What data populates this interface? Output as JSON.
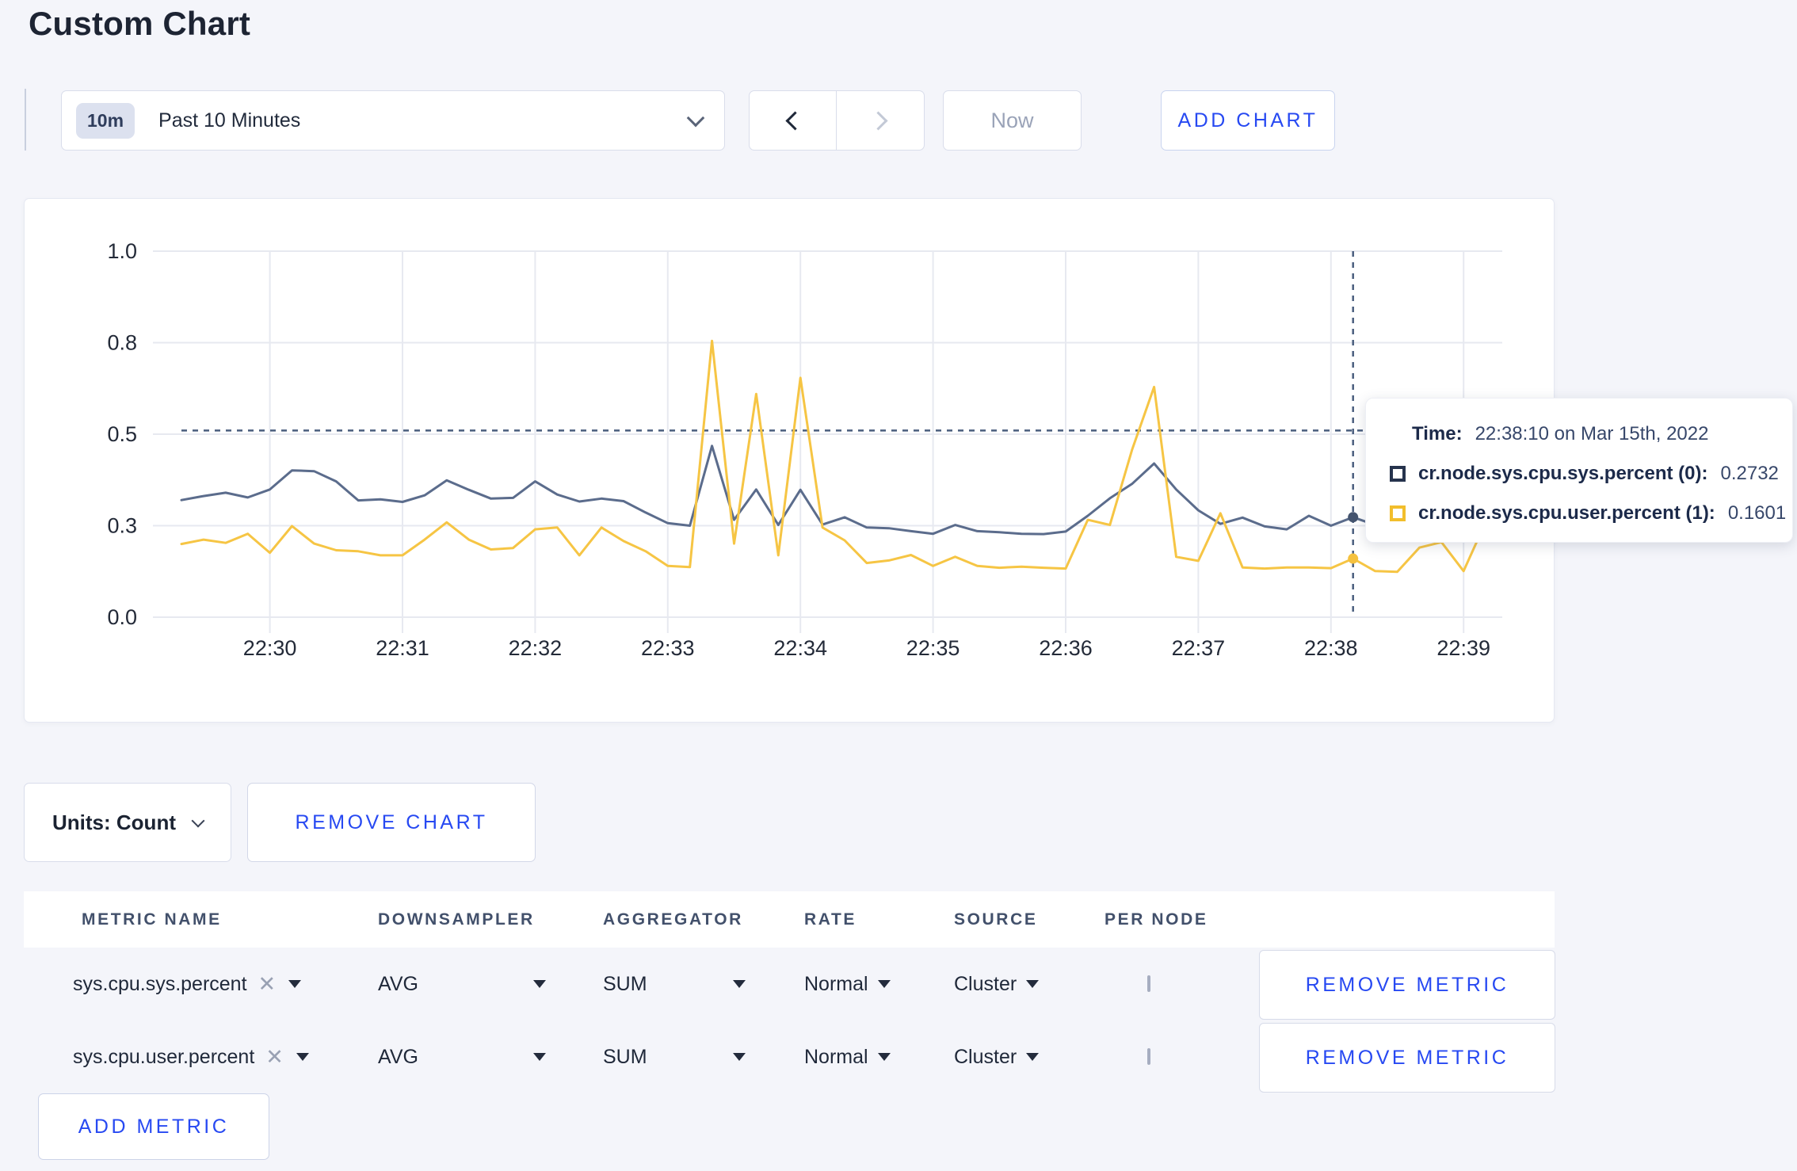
{
  "page": {
    "title": "Custom Chart"
  },
  "toolbar": {
    "time_window": {
      "badge": "10m",
      "label": "Past 10 Minutes"
    },
    "now_button": "Now",
    "add_chart_button": "ADD CHART"
  },
  "tooltip": {
    "time_label": "Time:",
    "time_value": "22:38:10 on Mar 15th, 2022",
    "series": [
      {
        "name": "cr.node.sys.cpu.sys.percent (0):",
        "value": "0.2732",
        "swatch_color": "#26334d"
      },
      {
        "name": "cr.node.sys.cpu.user.percent (1):",
        "value": "0.1601",
        "swatch_color": "#f2be2c"
      }
    ]
  },
  "units_bar": {
    "units_label": "Units: Count",
    "remove_chart_button": "REMOVE CHART"
  },
  "metrics_table": {
    "columns": [
      "METRIC NAME",
      "DOWNSAMPLER",
      "AGGREGATOR",
      "RATE",
      "SOURCE",
      "PER NODE"
    ],
    "rows": [
      {
        "metric": "sys.cpu.sys.percent",
        "downsampler": "AVG",
        "aggregator": "SUM",
        "rate": "Normal",
        "source": "Cluster",
        "per_node_checked": false,
        "remove_label": "REMOVE METRIC"
      },
      {
        "metric": "sys.cpu.user.percent",
        "downsampler": "AVG",
        "aggregator": "SUM",
        "rate": "Normal",
        "source": "Cluster",
        "per_node_checked": false,
        "remove_label": "REMOVE METRIC"
      }
    ],
    "add_metric_button": "ADD METRIC"
  },
  "chart_data": {
    "type": "line",
    "title": "",
    "xlabel": "",
    "ylabel": "",
    "ylim": [
      0,
      1
    ],
    "grid": true,
    "x_start_label": "22:29:20",
    "x_interval_sec": 10,
    "x_ticks": [
      {
        "offset_sec": 40,
        "label": "22:30"
      },
      {
        "offset_sec": 100,
        "label": "22:31"
      },
      {
        "offset_sec": 160,
        "label": "22:32"
      },
      {
        "offset_sec": 220,
        "label": "22:33"
      },
      {
        "offset_sec": 280,
        "label": "22:34"
      },
      {
        "offset_sec": 340,
        "label": "22:35"
      },
      {
        "offset_sec": 400,
        "label": "22:36"
      },
      {
        "offset_sec": 460,
        "label": "22:37"
      },
      {
        "offset_sec": 520,
        "label": "22:38"
      },
      {
        "offset_sec": 580,
        "label": "22:39"
      }
    ],
    "y_ticks": [
      {
        "value": 0,
        "label": "0.0"
      },
      {
        "value": 0.25,
        "label": "0.3"
      },
      {
        "value": 0.5,
        "label": "0.5"
      },
      {
        "value": 0.75,
        "label": "0.8"
      },
      {
        "value": 1,
        "label": "1.0"
      }
    ],
    "series": [
      {
        "name": "cr.node.sys.cpu.sys.percent (0)",
        "color": "#5b6c8c",
        "values": [
          0.32,
          0.331,
          0.34,
          0.327,
          0.349,
          0.401,
          0.399,
          0.371,
          0.319,
          0.322,
          0.315,
          0.333,
          0.374,
          0.348,
          0.324,
          0.326,
          0.371,
          0.335,
          0.316,
          0.324,
          0.317,
          0.286,
          0.257,
          0.25,
          0.468,
          0.266,
          0.349,
          0.252,
          0.348,
          0.253,
          0.273,
          0.245,
          0.243,
          0.235,
          0.228,
          0.252,
          0.235,
          0.232,
          0.228,
          0.227,
          0.234,
          0.277,
          0.325,
          0.364,
          0.42,
          0.349,
          0.292,
          0.255,
          0.272,
          0.248,
          0.24,
          0.277,
          0.25,
          0.2732,
          0.252,
          0.26,
          0.27,
          0.265,
          0.272,
          0.28
        ]
      },
      {
        "name": "cr.node.sys.cpu.user.percent (1)",
        "color": "#f6c544",
        "values": [
          0.2,
          0.212,
          0.203,
          0.228,
          0.176,
          0.249,
          0.201,
          0.183,
          0.18,
          0.169,
          0.169,
          0.212,
          0.259,
          0.212,
          0.185,
          0.189,
          0.24,
          0.245,
          0.169,
          0.245,
          0.208,
          0.18,
          0.14,
          0.137,
          0.755,
          0.201,
          0.61,
          0.169,
          0.654,
          0.245,
          0.21,
          0.148,
          0.155,
          0.17,
          0.14,
          0.165,
          0.14,
          0.135,
          0.138,
          0.135,
          0.133,
          0.266,
          0.252,
          0.457,
          0.629,
          0.165,
          0.154,
          0.284,
          0.136,
          0.133,
          0.136,
          0.136,
          0.134,
          0.1601,
          0.126,
          0.124,
          0.19,
          0.205,
          0.126,
          0.26
        ]
      }
    ],
    "crosshair": {
      "x_offset_sec": 530,
      "x_time_label": "22:38:10",
      "guideline_y_value": 0.51,
      "point_values": [
        0.2732,
        0.1601
      ],
      "point_colors": [
        "#44546f",
        "#f5c13e"
      ]
    },
    "legend_position": "tooltip-overlay",
    "colors": {
      "gridline": "#e7e9f0",
      "axis_text": "#232a38",
      "crosshair": "#4a5e7e"
    }
  }
}
